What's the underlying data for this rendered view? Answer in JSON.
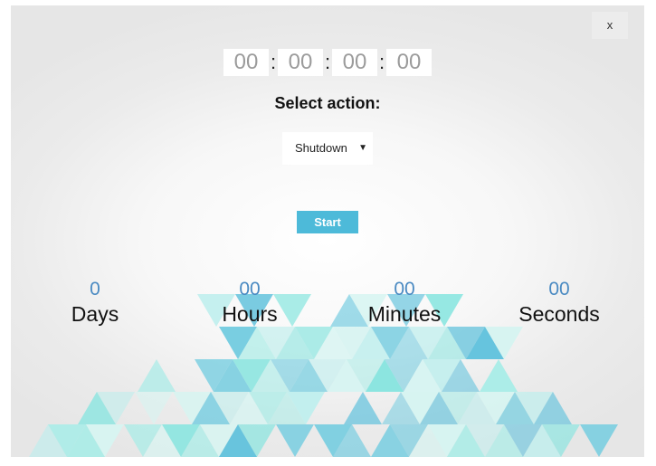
{
  "window": {
    "close_label": "x"
  },
  "timer": {
    "fields": [
      "00",
      "00",
      "00",
      "00"
    ],
    "separator": ":"
  },
  "action": {
    "label": "Select action:",
    "selected": "Shutdown",
    "arrow": "▼"
  },
  "start_button": {
    "label": "Start"
  },
  "countdown": [
    {
      "value": "0",
      "label": "Days"
    },
    {
      "value": "00",
      "label": "Hours"
    },
    {
      "value": "00",
      "label": "Minutes"
    },
    {
      "value": "00",
      "label": "Seconds"
    }
  ],
  "colors": {
    "accent": "#4dbad9",
    "countdown_number": "#4a8ac2",
    "triangle_palette": [
      "#8be5e0",
      "#a9ece7",
      "#5ec1dc",
      "#d6f4f1",
      "#76cde0",
      "#bfeeed"
    ]
  }
}
